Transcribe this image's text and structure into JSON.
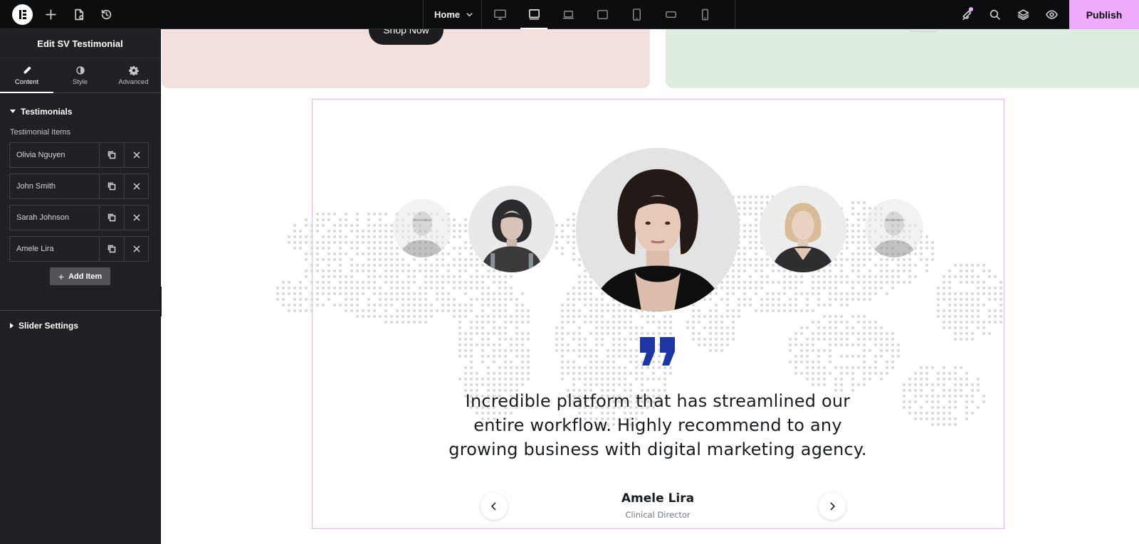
{
  "topbar": {
    "page_selector": "Home",
    "publish_label": "Publish",
    "icons": [
      "elementor-logo-icon",
      "add-icon",
      "page-settings-icon",
      "history-icon",
      "notifications-icon",
      "search-icon",
      "structure-icon",
      "preview-icon"
    ],
    "devices": [
      "desktop",
      "tablet-landscape",
      "laptop",
      "tablet-extra",
      "tablet",
      "mobile-extra",
      "mobile"
    ],
    "active_device": "tablet-landscape",
    "accent": "#f0abfc"
  },
  "sidebar": {
    "title": "Edit SV Testimonial",
    "tabs": [
      {
        "label": "Content",
        "icon": "pencil-icon",
        "active": true
      },
      {
        "label": "Style",
        "icon": "half-circle-icon",
        "active": false
      },
      {
        "label": "Advanced",
        "icon": "gear-icon",
        "active": false
      }
    ],
    "section_testimonials": "Testimonials",
    "items_label": "Testimonial Items",
    "items": [
      "Olivia Nguyen",
      "John Smith",
      "Sarah Johnson",
      "Amele Lira"
    ],
    "add_item_label": "Add Item",
    "section_slider": "Slider Settings"
  },
  "canvas": {
    "shop_button": "Shop Now",
    "quote": "Incredible platform that has streamlined our entire workflow. Highly recommend to any growing business with digital marketing agency.",
    "author_name": "Amele Lira",
    "author_role": "Clinical Director",
    "quote_color": "#1e35a6",
    "pink_card_color": "#f2e0df",
    "green_card_color": "#dfede1"
  }
}
